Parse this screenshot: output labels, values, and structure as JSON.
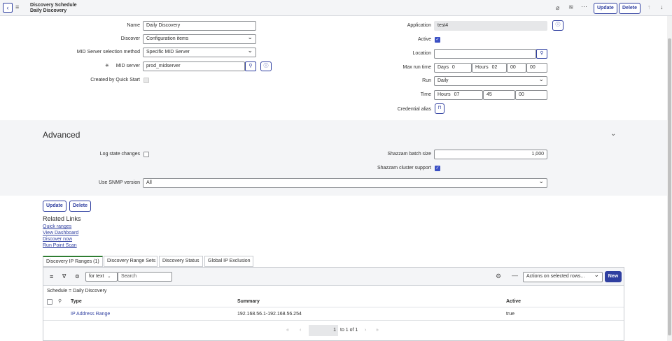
{
  "header": {
    "back_icon": "chevron-left-icon",
    "title": "Discovery Schedule",
    "subtitle": "Daily Discovery",
    "update_label": "Update",
    "delete_label": "Delete"
  },
  "form": {
    "name_label": "Name",
    "name_value": "Daily Discovery",
    "discover_label": "Discover",
    "discover_value": "Configuration items",
    "mid_method_label": "MID Server selection method",
    "mid_method_value": "Specific MID Server",
    "mid_server_label": "MID server",
    "mid_server_required": "✳",
    "mid_server_value": "prod_midserver",
    "quick_start_label": "Created by Quick Start",
    "application_label": "Application",
    "application_value": "test4",
    "active_label": "Active",
    "location_label": "Location",
    "location_value": "",
    "max_run_label": "Max run time",
    "max_run_days_label": "Days",
    "max_run_days": "0",
    "max_run_hours_label": "Hours",
    "max_run_hours": "02",
    "max_run_minutes": "00",
    "max_run_seconds": "00",
    "run_label": "Run",
    "run_value": "Daily",
    "time_label": "Time",
    "time_hours_label": "Hours",
    "time_hours": "07",
    "time_minutes": "45",
    "time_seconds": "00",
    "credential_label": "Credential alias"
  },
  "advanced": {
    "title": "Advanced",
    "log_state_label": "Log state changes",
    "batch_size_label": "Shazzam batch size",
    "batch_size_value": "1,000",
    "cluster_label": "Shazzam cluster support",
    "snmp_label": "Use SNMP version",
    "snmp_value": "All"
  },
  "actions": {
    "update_label": "Update",
    "delete_label": "Delete"
  },
  "related": {
    "title": "Related Links",
    "links": [
      "Quick ranges",
      "View Dashboard",
      "Discover now",
      "Run Point Scan"
    ]
  },
  "tabs": [
    "Discovery IP Ranges (1)",
    "Discovery Range Sets",
    "Discovery Status",
    "Global IP Exclusion"
  ],
  "list": {
    "search_field": "for text",
    "search_placeholder": "Search",
    "actions_select": "Actions on selected rows...",
    "new_label": "New",
    "filter_text": "Schedule = Daily Discovery",
    "columns": [
      "Type",
      "Summary",
      "Active"
    ],
    "rows": [
      {
        "type": "IP Address Range",
        "summary": "192.168.56.1-192.168.56.254",
        "active": "true"
      }
    ],
    "page_value": "1",
    "page_text": "to 1 of 1"
  }
}
